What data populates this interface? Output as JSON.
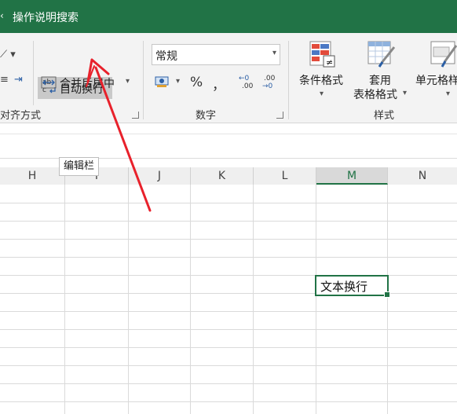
{
  "title_bar": {
    "title": "操作说明搜索"
  },
  "ribbon": {
    "alignment": {
      "wrap_text_label": "自动换行",
      "merge_center_label": "合并后居中",
      "group_label": "对齐方式",
      "wrap_icon_ab": "ab",
      "wrap_icon_c": "c"
    },
    "number": {
      "format_value": "常规",
      "percent_symbol": "%",
      "comma_symbol": "，",
      "increase_decimal_top": "←0",
      "increase_decimal_bottom": ".00",
      "decrease_decimal_top": ".00",
      "decrease_decimal_bottom": "→0",
      "group_label": "数字"
    },
    "styles": {
      "conditional_format_label": "条件格式",
      "table_format_line1": "套用",
      "table_format_line2": "表格格式",
      "cell_styles_label": "单元格样",
      "group_label": "样式"
    }
  },
  "tooltip": {
    "text": "编辑栏"
  },
  "columns": [
    "H",
    "I",
    "J",
    "K",
    "L",
    "M",
    "N"
  ],
  "selected_column": "M",
  "active_cell": {
    "text": "文本换行"
  },
  "colors": {
    "accent": "#217346",
    "arrow": "#e8212b"
  }
}
